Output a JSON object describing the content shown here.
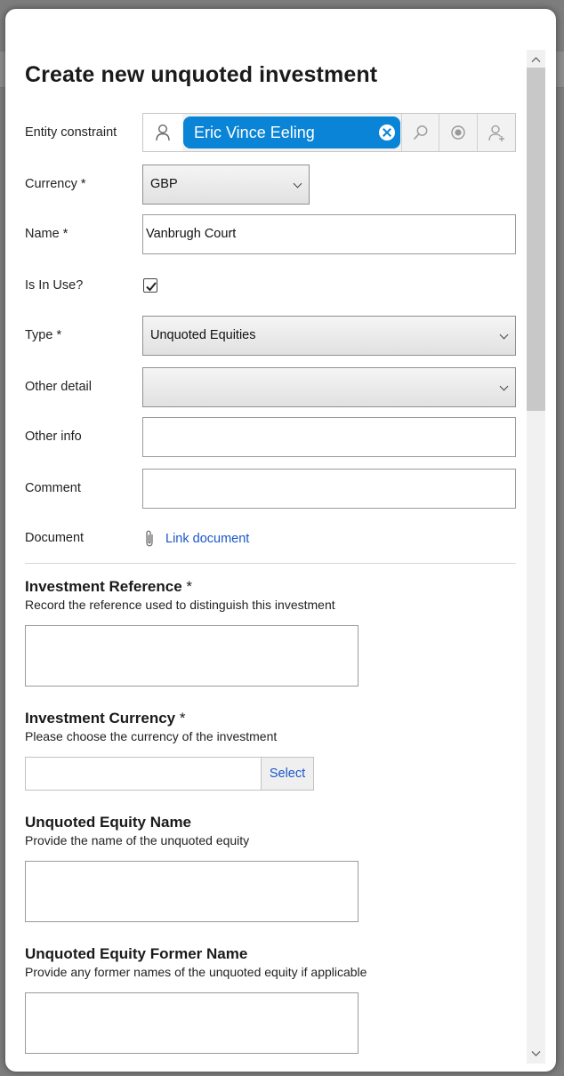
{
  "dialog": {
    "title": "Create new unquoted investment"
  },
  "fields": {
    "entity_constraint": {
      "label": "Entity constraint",
      "value": "Eric Vince Eeling",
      "icons": [
        "person-icon",
        "clear-icon",
        "search-icon",
        "target-icon",
        "add-person-icon"
      ]
    },
    "currency": {
      "label": "Currency *",
      "value": "GBP"
    },
    "name": {
      "label": "Name *",
      "value": "Vanbrugh Court"
    },
    "is_in_use": {
      "label": "Is In Use?",
      "checked": true
    },
    "type": {
      "label": "Type *",
      "value": "Unquoted Equities"
    },
    "other_detail": {
      "label": "Other detail",
      "value": ""
    },
    "other_info": {
      "label": "Other info",
      "value": ""
    },
    "comment": {
      "label": "Comment",
      "value": ""
    },
    "document": {
      "label": "Document",
      "link_label": "Link document",
      "icon": "paperclip-icon"
    }
  },
  "sections": {
    "investment_reference": {
      "title": "Investment Reference",
      "required_marker": " *",
      "help": "Record the reference used to distinguish this investment",
      "value": ""
    },
    "investment_currency": {
      "title": "Investment Currency",
      "required_marker": " *",
      "help": "Please choose the currency of the investment",
      "value": "",
      "button_label": "Select"
    },
    "unquoted_equity_name": {
      "title": "Unquoted Equity Name",
      "help": "Provide the name of the unquoted equity",
      "value": ""
    },
    "unquoted_equity_former_name": {
      "title": "Unquoted Equity Former Name",
      "help": "Provide any former names of the unquoted equity if applicable",
      "value": ""
    }
  },
  "colors": {
    "chip": "#0a84d6",
    "link": "#1a57c9"
  }
}
